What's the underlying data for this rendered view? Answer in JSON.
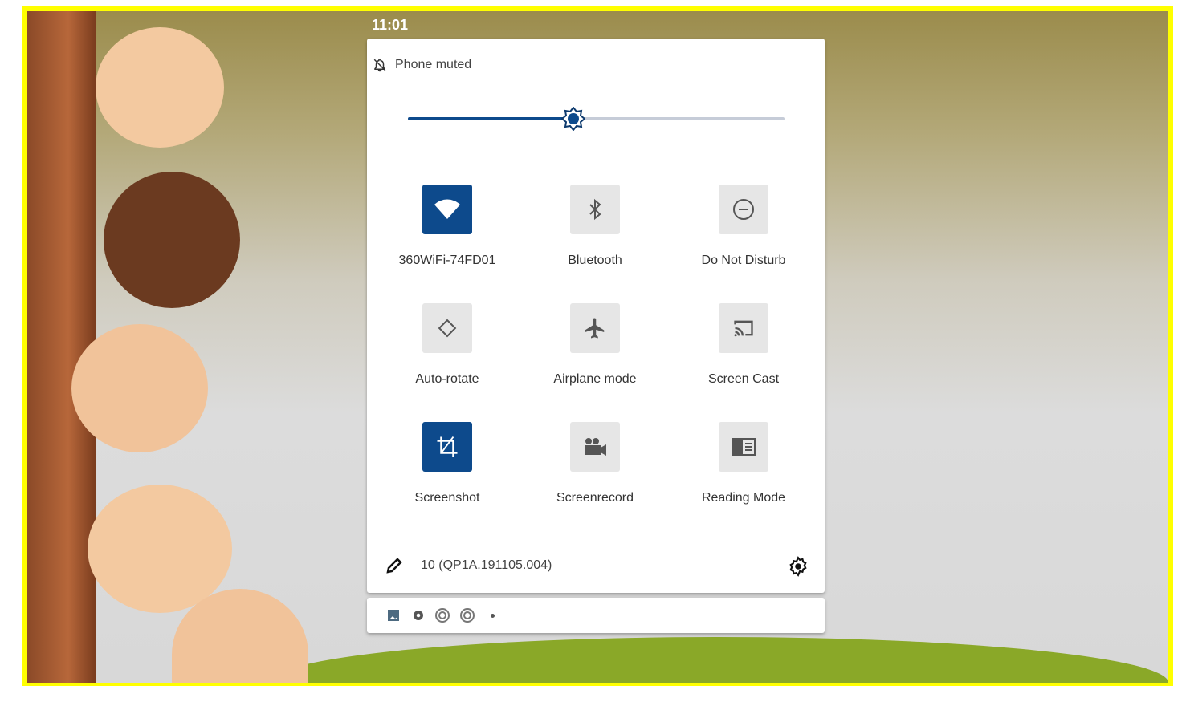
{
  "status_bar": {
    "time": "11:01"
  },
  "quick_settings": {
    "ringer_status": "Phone muted",
    "brightness_percent": 44,
    "tiles": [
      {
        "label": "360WiFi-74FD01",
        "icon": "wifi-icon",
        "active": true
      },
      {
        "label": "Bluetooth",
        "icon": "bluetooth-icon",
        "active": false
      },
      {
        "label": "Do Not Disturb",
        "icon": "do-not-disturb-icon",
        "active": false
      },
      {
        "label": "Auto-rotate",
        "icon": "auto-rotate-icon",
        "active": false
      },
      {
        "label": "Airplane mode",
        "icon": "airplane-icon",
        "active": false
      },
      {
        "label": "Screen Cast",
        "icon": "cast-icon",
        "active": false
      },
      {
        "label": "Screenshot",
        "icon": "crop-icon",
        "active": true
      },
      {
        "label": "Screenrecord",
        "icon": "video-camera-icon",
        "active": false
      },
      {
        "label": "Reading Mode",
        "icon": "reading-mode-icon",
        "active": false
      }
    ],
    "build_number": "10 (QP1A.191105.004)"
  },
  "notification_icons": [
    "image-icon",
    "gear-icon",
    "sync-icon",
    "sync-icon",
    "more-dot-icon"
  ],
  "colors": {
    "accent": "#0d4a8c",
    "frame": "#ffff00"
  }
}
